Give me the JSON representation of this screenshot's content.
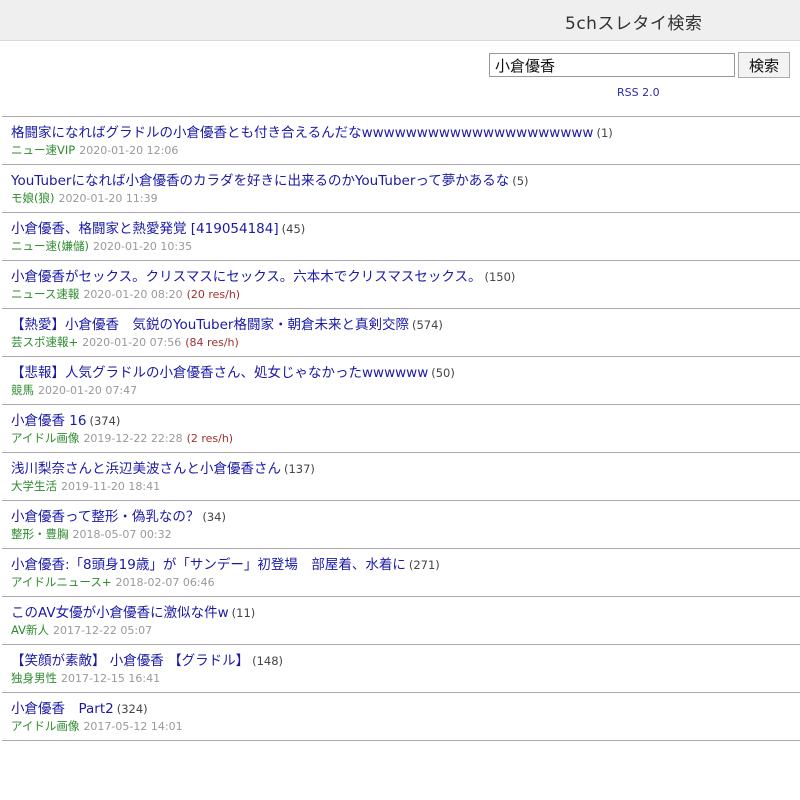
{
  "header": {
    "title": "5chスレタイ検索"
  },
  "search": {
    "value": "小倉優香",
    "button_label": "検索",
    "rss_label": "RSS 2.0"
  },
  "results": [
    {
      "title": "格闘家になればグラドルの小倉優香とも付き合えるんだなwwwwwwwwwwwwwwwwwwwww",
      "count": "(1)",
      "board": "ニュー速VIP",
      "date": "2020-01-20 12:06",
      "rate": ""
    },
    {
      "title": "YouTuberになれば小倉優香のカラダを好きに出来るのかYouTuberって夢かあるな",
      "count": "(5)",
      "board": "モ娘(狼)",
      "date": "2020-01-20 11:39",
      "rate": ""
    },
    {
      "title": "小倉優香、格闘家と熱愛発覚 [419054184]",
      "count": "(45)",
      "board": "ニュー速(嫌儲)",
      "date": "2020-01-20 10:35",
      "rate": ""
    },
    {
      "title": "小倉優香がセックス。クリスマスにセックス。六本木でクリスマスセックス。",
      "count": "(150)",
      "board": "ニュース速報",
      "date": "2020-01-20 08:20",
      "rate": "(20 res/h)"
    },
    {
      "title": "【熱愛】小倉優香　気鋭のYouTuber格闘家・朝倉未来と真剣交際",
      "count": "(574)",
      "board": "芸スポ速報+",
      "date": "2020-01-20 07:56",
      "rate": "(84 res/h)"
    },
    {
      "title": "【悲報】人気グラドルの小倉優香さん、処女じゃなかったwwwwww",
      "count": "(50)",
      "board": "競馬",
      "date": "2020-01-20 07:47",
      "rate": ""
    },
    {
      "title": "小倉優香 16",
      "count": "(374)",
      "board": "アイドル画像",
      "date": "2019-12-22 22:28",
      "rate": "(2 res/h)"
    },
    {
      "title": "浅川梨奈さんと浜辺美波さんと小倉優香さん",
      "count": "(137)",
      "board": "大学生活",
      "date": "2019-11-20 18:41",
      "rate": ""
    },
    {
      "title": "小倉優香って整形・偽乳なの？",
      "count": "(34)",
      "board": "整形・豊胸",
      "date": "2018-05-07 00:32",
      "rate": ""
    },
    {
      "title": "小倉優香:「8頭身19歳」が「サンデー」初登場　部屋着、水着に",
      "count": "(271)",
      "board": "アイドルニュース+",
      "date": "2018-02-07 06:46",
      "rate": ""
    },
    {
      "title": "このAV女優が小倉優香に激似な件w",
      "count": "(11)",
      "board": "AV新人",
      "date": "2017-12-22 05:07",
      "rate": ""
    },
    {
      "title": "【笑顔が素敵】 小倉優香 【グラドル】",
      "count": "(148)",
      "board": "独身男性",
      "date": "2017-12-15 16:41",
      "rate": ""
    },
    {
      "title": "小倉優香　Part2",
      "count": "(324)",
      "board": "アイドル画像",
      "date": "2017-05-12 14:01",
      "rate": ""
    }
  ]
}
